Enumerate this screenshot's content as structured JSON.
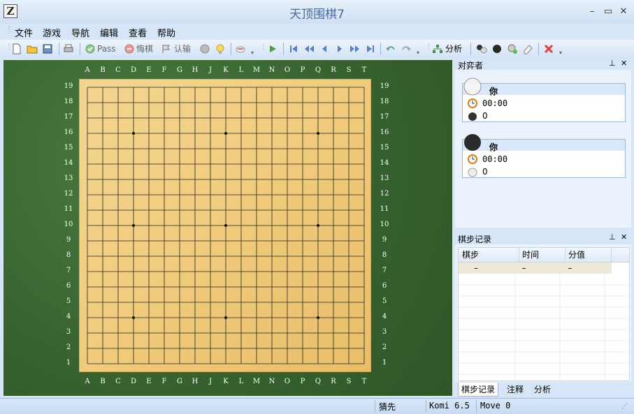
{
  "window": {
    "title": "天顶围棋7",
    "icon_letter": "Z"
  },
  "menu": [
    "文件",
    "游戏",
    "导航",
    "编辑",
    "查看",
    "帮助"
  ],
  "toolbar": {
    "pass_label": "Pass",
    "undo_label": "悔棋",
    "resign_label": "认输",
    "analysis_label": "分析"
  },
  "board": {
    "size": 19,
    "columns": [
      "A",
      "B",
      "C",
      "D",
      "E",
      "F",
      "G",
      "H",
      "J",
      "K",
      "L",
      "M",
      "N",
      "O",
      "P",
      "Q",
      "R",
      "S",
      "T"
    ],
    "rows": [
      "19",
      "18",
      "17",
      "16",
      "15",
      "14",
      "13",
      "12",
      "11",
      "10",
      "9",
      "8",
      "7",
      "6",
      "5",
      "4",
      "3",
      "2",
      "1"
    ]
  },
  "players_panel": {
    "title": "对弈者",
    "white": {
      "name": "你",
      "time": "00:00",
      "captures": "0"
    },
    "black": {
      "name": "你",
      "time": "00:00",
      "captures": "0"
    }
  },
  "moves_panel": {
    "title": "棋步记录",
    "columns": [
      "棋步",
      "时间",
      "分值"
    ],
    "rows": [
      [
        "–",
        "–",
        "–"
      ]
    ],
    "tabs": [
      "棋步记录",
      "注释",
      "分析"
    ]
  },
  "status": {
    "rule": "猜先",
    "komi": "Komi 6.5",
    "move": "Move 0"
  },
  "colors": {
    "accent": "#d6e6f8",
    "felt": "#3f6b35",
    "board": "#efc97a"
  }
}
